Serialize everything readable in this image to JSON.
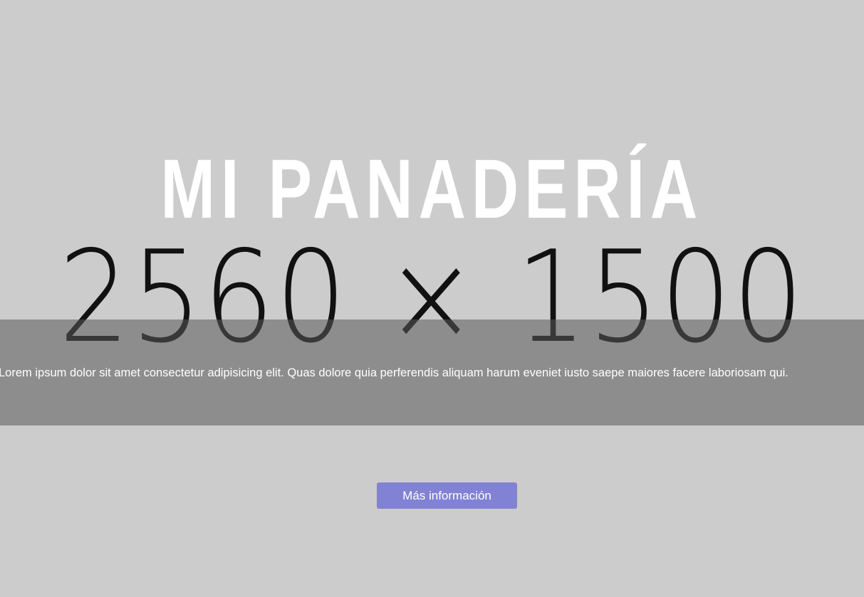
{
  "hero": {
    "placeholder_dimensions": "2560 × 1500",
    "title": "MI PANADERÍA",
    "description": "Lorem ipsum dolor sit amet consectetur adipisicing elit. Quas dolore quia perferendis aliquam harum eveniet iusto saepe maiores facere laboriosam qui.",
    "button_label": "Más información"
  },
  "colors": {
    "background": "#cccccc",
    "title": "#ffffff",
    "placeholder_text": "#111111",
    "overlay": "#7f7f7f",
    "button": "#8282d4",
    "button_text": "#ffffff"
  }
}
